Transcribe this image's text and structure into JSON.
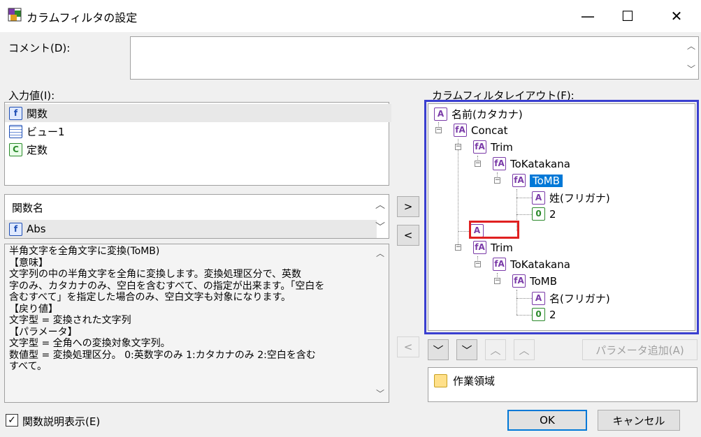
{
  "window": {
    "title": "カラムフィルタの設定",
    "controls": {
      "minimize": "—",
      "maximize": "☐",
      "close": "✕"
    }
  },
  "comment": {
    "label": "コメント(D):",
    "value": ""
  },
  "input": {
    "label": "入力値(I):",
    "items": [
      {
        "label": "関数",
        "icon": "function-book-icon"
      },
      {
        "label": "ビュー1",
        "icon": "grid-view-icon"
      },
      {
        "label": "定数",
        "icon": "constant-icon"
      }
    ]
  },
  "function_list": {
    "header": "関数名",
    "items": [
      {
        "label": "Abs",
        "icon": "function-icon"
      }
    ]
  },
  "description": {
    "lines": [
      "半角文字を全角文字に変換(ToMB)",
      "【意味】",
      "文字列の中の半角文字を全角に変換します。変換処理区分で、英数",
      "字のみ、カタカナのみ、空白を含むすべて、の指定が出来ます。「空白を",
      "含むすべて」を指定した場合のみ、空白文字も対象になります。",
      "【戻り値】",
      "文字型 = 変換された文字列",
      "【パラメータ】",
      "文字型 = 全角への変換対象文字列。",
      "数値型 = 変換処理区分。 0:英数字のみ 1:カタカナのみ 2:空白を含む",
      "すべて。"
    ]
  },
  "show_description": {
    "label": "関数説明表示(E)",
    "checked": true,
    "mark": "✓"
  },
  "layout": {
    "label": "カラムフィルタレイアウト(F):",
    "nodes": [
      {
        "text": "名前(カタカナ)",
        "icon": "A"
      },
      {
        "text": "Concat",
        "icon": "fA"
      },
      {
        "text": "Trim",
        "icon": "fA"
      },
      {
        "text": "ToKatakana",
        "icon": "fA"
      },
      {
        "text": "ToMB",
        "icon": "fA"
      },
      {
        "text": "姓(フリガナ)",
        "icon": "A"
      },
      {
        "text": "2",
        "icon": "E0"
      },
      {
        "text": "",
        "icon": "EA"
      },
      {
        "text": "Trim",
        "icon": "fA"
      },
      {
        "text": "ToKatakana",
        "icon": "fA"
      },
      {
        "text": "ToMB",
        "icon": "fA"
      },
      {
        "text": "名(フリガナ)",
        "icon": "A"
      },
      {
        "text": "2",
        "icon": "E0"
      }
    ]
  },
  "arrows": {
    "right": ">",
    "left": "<",
    "left_disabled": "<"
  },
  "order_buttons": {
    "down": "﹀",
    "down_child": "﹀",
    "up": "︿",
    "up_child": "︿"
  },
  "add_param": {
    "label": "パラメータ追加(A)"
  },
  "workspace": {
    "label": "作業領域"
  },
  "ok": {
    "label": "OK"
  },
  "cancel": {
    "label": "キャンセル"
  },
  "colors": {
    "highlight_blue": "#3a3fd0",
    "highlight_red": "#e02020",
    "selection": "#0078d7"
  }
}
